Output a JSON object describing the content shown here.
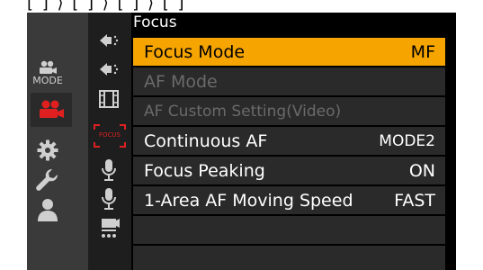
{
  "top_strip_text": "[ ] ⟩ [ ] ⟩ [ ] ⟩ [ ]",
  "menu": {
    "title": "Focus",
    "items": [
      {
        "label": "Focus Mode",
        "value": "MF",
        "state": "selected"
      },
      {
        "label": "AF Mode",
        "value": "",
        "state": "disabled"
      },
      {
        "label": "AF Custom Setting(Video)",
        "value": "",
        "state": "disabled"
      },
      {
        "label": "Continuous AF",
        "value": "MODE2",
        "state": "normal"
      },
      {
        "label": "Focus Peaking",
        "value": "ON",
        "state": "normal"
      },
      {
        "label": "1-Area AF Moving Speed",
        "value": "FAST",
        "state": "normal"
      }
    ]
  },
  "sidebar": {
    "mode_label": "MODE",
    "tabs": [
      "mode-icon",
      "video-camera-icon",
      "gear-icon",
      "wrench-icon",
      "person-icon"
    ],
    "selected_tab": "video-camera-icon"
  },
  "subtabs": {
    "focus_label": "FOCUS",
    "items": [
      "exposure-icon",
      "exposure-2-icon",
      "film-icon",
      "focus-icon",
      "mic-icon",
      "mic-2-icon",
      "camera-stand-icon"
    ],
    "selected": "focus-icon"
  },
  "colors": {
    "accent": "#f5a400",
    "selected_tab_red": "#e02020",
    "row_bg": "#2a2a2a",
    "disabled_text": "#6a6a6a"
  }
}
